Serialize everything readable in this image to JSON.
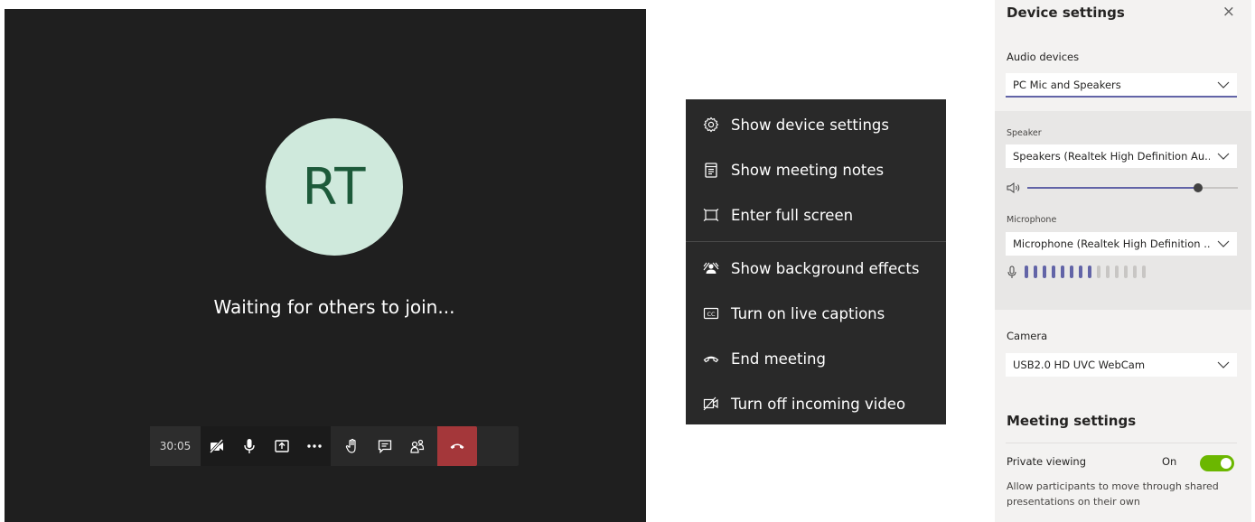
{
  "stage": {
    "avatar_initials": "RT",
    "status_text": "Waiting for others to join...",
    "timer": "30:05"
  },
  "toolbar": {
    "buttons": [
      "camera-off-icon",
      "microphone-icon",
      "share-screen-icon",
      "more-actions-icon",
      "raise-hand-icon",
      "chat-icon",
      "participants-icon",
      "hang-up-icon"
    ],
    "hangup_color": "#a4373a"
  },
  "menu": {
    "items": [
      {
        "label": "Show device settings",
        "icon": "gear-icon"
      },
      {
        "label": "Show meeting notes",
        "icon": "notes-icon"
      },
      {
        "label": "Enter full screen",
        "icon": "fullscreen-icon"
      },
      {
        "label": "Show background effects",
        "icon": "background-effects-icon"
      },
      {
        "label": "Turn on live captions",
        "icon": "captions-icon"
      },
      {
        "label": "End meeting",
        "icon": "end-call-icon"
      },
      {
        "label": "Turn off incoming video",
        "icon": "video-off-icon"
      }
    ]
  },
  "device_settings": {
    "title": "Device settings",
    "close_label": "×",
    "audio_devices_label": "Audio devices",
    "audio_device_value": "PC Mic and Speakers",
    "speaker_label": "Speaker",
    "speaker_value": "Speakers (Realtek High Definition Au...",
    "speaker_volume_fraction": 0.81,
    "microphone_label": "Microphone",
    "microphone_value": "Microphone (Realtek High Definition ...",
    "mic_level_active_bars": 8,
    "mic_level_total_bars": 14,
    "camera_label": "Camera",
    "camera_value": "USB2.0 HD UVC WebCam",
    "meeting_settings_label": "Meeting settings",
    "private_viewing_label": "Private viewing",
    "private_viewing_state": "On",
    "private_viewing_desc": "Allow participants to move through shared presentations on their own",
    "accent_color": "#6264a7",
    "toggle_color": "#6bb700"
  }
}
